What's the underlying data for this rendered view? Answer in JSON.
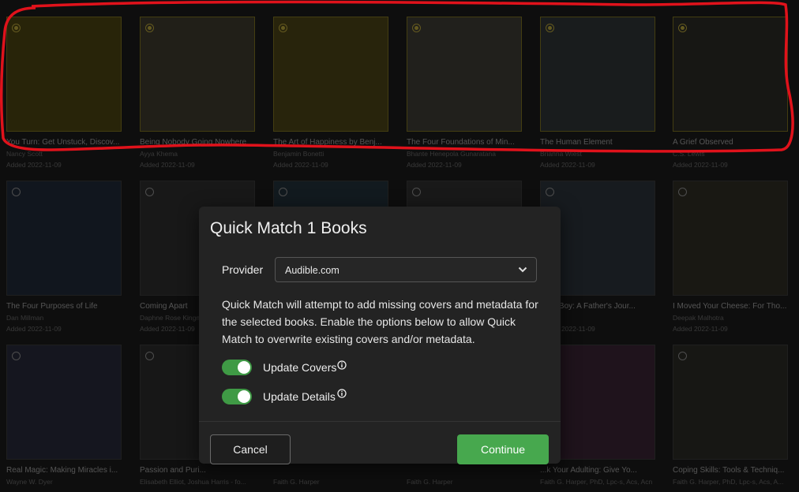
{
  "colors": {
    "accent_green": "#47a84e",
    "selected_radio": "#b5a23a",
    "annotation_red": "#e0121b"
  },
  "books": [
    {
      "title": "You Turn: Get Unstuck, Discov...",
      "author": "Nancy Scott",
      "added": "Added 2022-11-09",
      "selected": true,
      "cover_color": "#4a4212"
    },
    {
      "title": "Being Nobody Going Nowhere",
      "author": "Ayya Khema",
      "added": "Added 2022-11-09",
      "selected": true,
      "cover_color": "#3d3a2c"
    },
    {
      "title": "The Art of Happiness by Benj...",
      "author": "Benjamin Bonetti",
      "added": "Added 2022-11-09",
      "selected": true,
      "cover_color": "#4a4216"
    },
    {
      "title": "The Four Foundations of Min...",
      "author": "Bhante Henepola Gunaratana",
      "added": "Added 2022-11-09",
      "selected": true,
      "cover_color": "#3d3b33"
    },
    {
      "title": "The Human Element",
      "author": "Brianna Wiest",
      "added": "Added 2022-11-09",
      "selected": true,
      "cover_color": "#2f3336"
    },
    {
      "title": "A Grief Observed",
      "author": "C.S. Lewis",
      "added": "Added 2022-11-09",
      "selected": true,
      "cover_color": "#2a2a26"
    },
    {
      "title": "The Four Purposes of Life",
      "author": "Dan Millman",
      "added": "Added 2022-11-09",
      "selected": false,
      "cover_color": "#1f2838"
    },
    {
      "title": "Coming Apart",
      "author": "Daphne Rose Kingma",
      "added": "Added 2022-11-09",
      "selected": false,
      "cover_color": "#2c2c2c"
    },
    {
      "title": "",
      "author": "",
      "added": "",
      "selected": false,
      "cover_color": "#22303a"
    },
    {
      "title": "",
      "author": "",
      "added": "",
      "selected": false,
      "cover_color": "#2e2e2e"
    },
    {
      "title": "...iful Boy: A Father's Jour...",
      "author": "...heff",
      "added": "Added 2022-11-09",
      "selected": false,
      "cover_color": "#2b323a"
    },
    {
      "title": "I Moved Your Cheese: For Tho...",
      "author": "Deepak Malhotra",
      "added": "Added 2022-11-09",
      "selected": false,
      "cover_color": "#2e2c24"
    },
    {
      "title": "Real Magic: Making Miracles i...",
      "author": "Wayne W. Dyer",
      "added": "",
      "selected": false,
      "cover_color": "#27283a"
    },
    {
      "title": "Passion and Puri...",
      "author": "Elisabeth Elliot, Joshua Harris - fo...",
      "added": "",
      "selected": false,
      "cover_color": "#2a2a2a"
    },
    {
      "title": "",
      "author": "Faith G. Harper",
      "added": "",
      "selected": false,
      "cover_color": "#2a2a2a"
    },
    {
      "title": "",
      "author": "Faith G. Harper",
      "added": "",
      "selected": false,
      "cover_color": "#2a2a2a"
    },
    {
      "title": "...k Your Adulting: Give Yo...",
      "author": "Faith G. Harper, PhD, Lpc-s, Acs, Acn",
      "added": "",
      "selected": false,
      "cover_color": "#3a2434"
    },
    {
      "title": "Coping Skills: Tools & Techniq...",
      "author": "Faith G. Harper, PhD, Lpc-s, Acs, A...",
      "added": "",
      "selected": false,
      "cover_color": "#2b2a26"
    }
  ],
  "modal": {
    "title_prefix": "Quick Match",
    "title_count": "1 Books",
    "provider_label": "Provider",
    "provider_value": "Audible.com",
    "description": "Quick Match will attempt to add missing covers and metadata for the selected books. Enable the options below to allow Quick Match to overwrite existing covers and/or metadata.",
    "update_covers_label": "Update Covers",
    "update_covers_on": true,
    "update_details_label": "Update Details",
    "update_details_on": true,
    "cancel_label": "Cancel",
    "continue_label": "Continue"
  }
}
